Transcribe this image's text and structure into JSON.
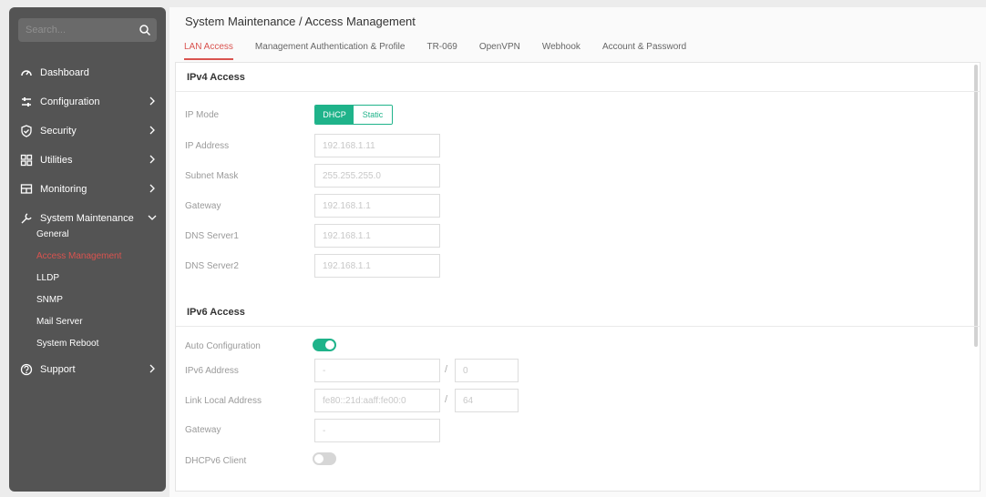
{
  "sidebar": {
    "search_placeholder": "Search...",
    "items": [
      {
        "label": "Dashboard"
      },
      {
        "label": "Configuration"
      },
      {
        "label": "Security"
      },
      {
        "label": "Utilities"
      },
      {
        "label": "Monitoring"
      },
      {
        "label": "System Maintenance"
      },
      {
        "label": "Support"
      }
    ],
    "sub_items": [
      {
        "label": "General"
      },
      {
        "label": "Access Management"
      },
      {
        "label": "LLDP"
      },
      {
        "label": "SNMP"
      },
      {
        "label": "Mail Server"
      },
      {
        "label": "System Reboot"
      }
    ]
  },
  "header": {
    "breadcrumb": "System Maintenance /  Access Management"
  },
  "tabs": [
    {
      "label": "LAN Access"
    },
    {
      "label": "Management Authentication & Profile"
    },
    {
      "label": "TR-069"
    },
    {
      "label": "OpenVPN"
    },
    {
      "label": "Webhook"
    },
    {
      "label": "Account & Password"
    }
  ],
  "ipv4": {
    "title": "IPv4 Access",
    "ip_mode_label": "IP Mode",
    "mode_dhcp": "DHCP",
    "mode_static": "Static",
    "ip_address_label": "IP Address",
    "ip_address_value": "192.168.1.11",
    "subnet_label": "Subnet Mask",
    "subnet_value": "255.255.255.0",
    "gateway_label": "Gateway",
    "gateway_value": "192.168.1.1",
    "dns1_label": "DNS Server1",
    "dns1_value": "192.168.1.1",
    "dns2_label": "DNS Server2",
    "dns2_value": "192.168.1.1"
  },
  "ipv6": {
    "title": "IPv6 Access",
    "auto_label": "Auto Configuration",
    "address_label": "IPv6 Address",
    "address_value": "-",
    "prefix_value": "0",
    "link_local_label": "Link Local Address",
    "link_local_value": "fe80::21d:aaff:fe00:0",
    "link_local_prefix": "64",
    "gateway_label": "Gateway",
    "gateway_value": "-",
    "dhcpv6_label": "DHCPv6 Client",
    "slash": "/"
  },
  "colors": {
    "accent": "#1fb38a",
    "active_red": "#d9534f"
  }
}
